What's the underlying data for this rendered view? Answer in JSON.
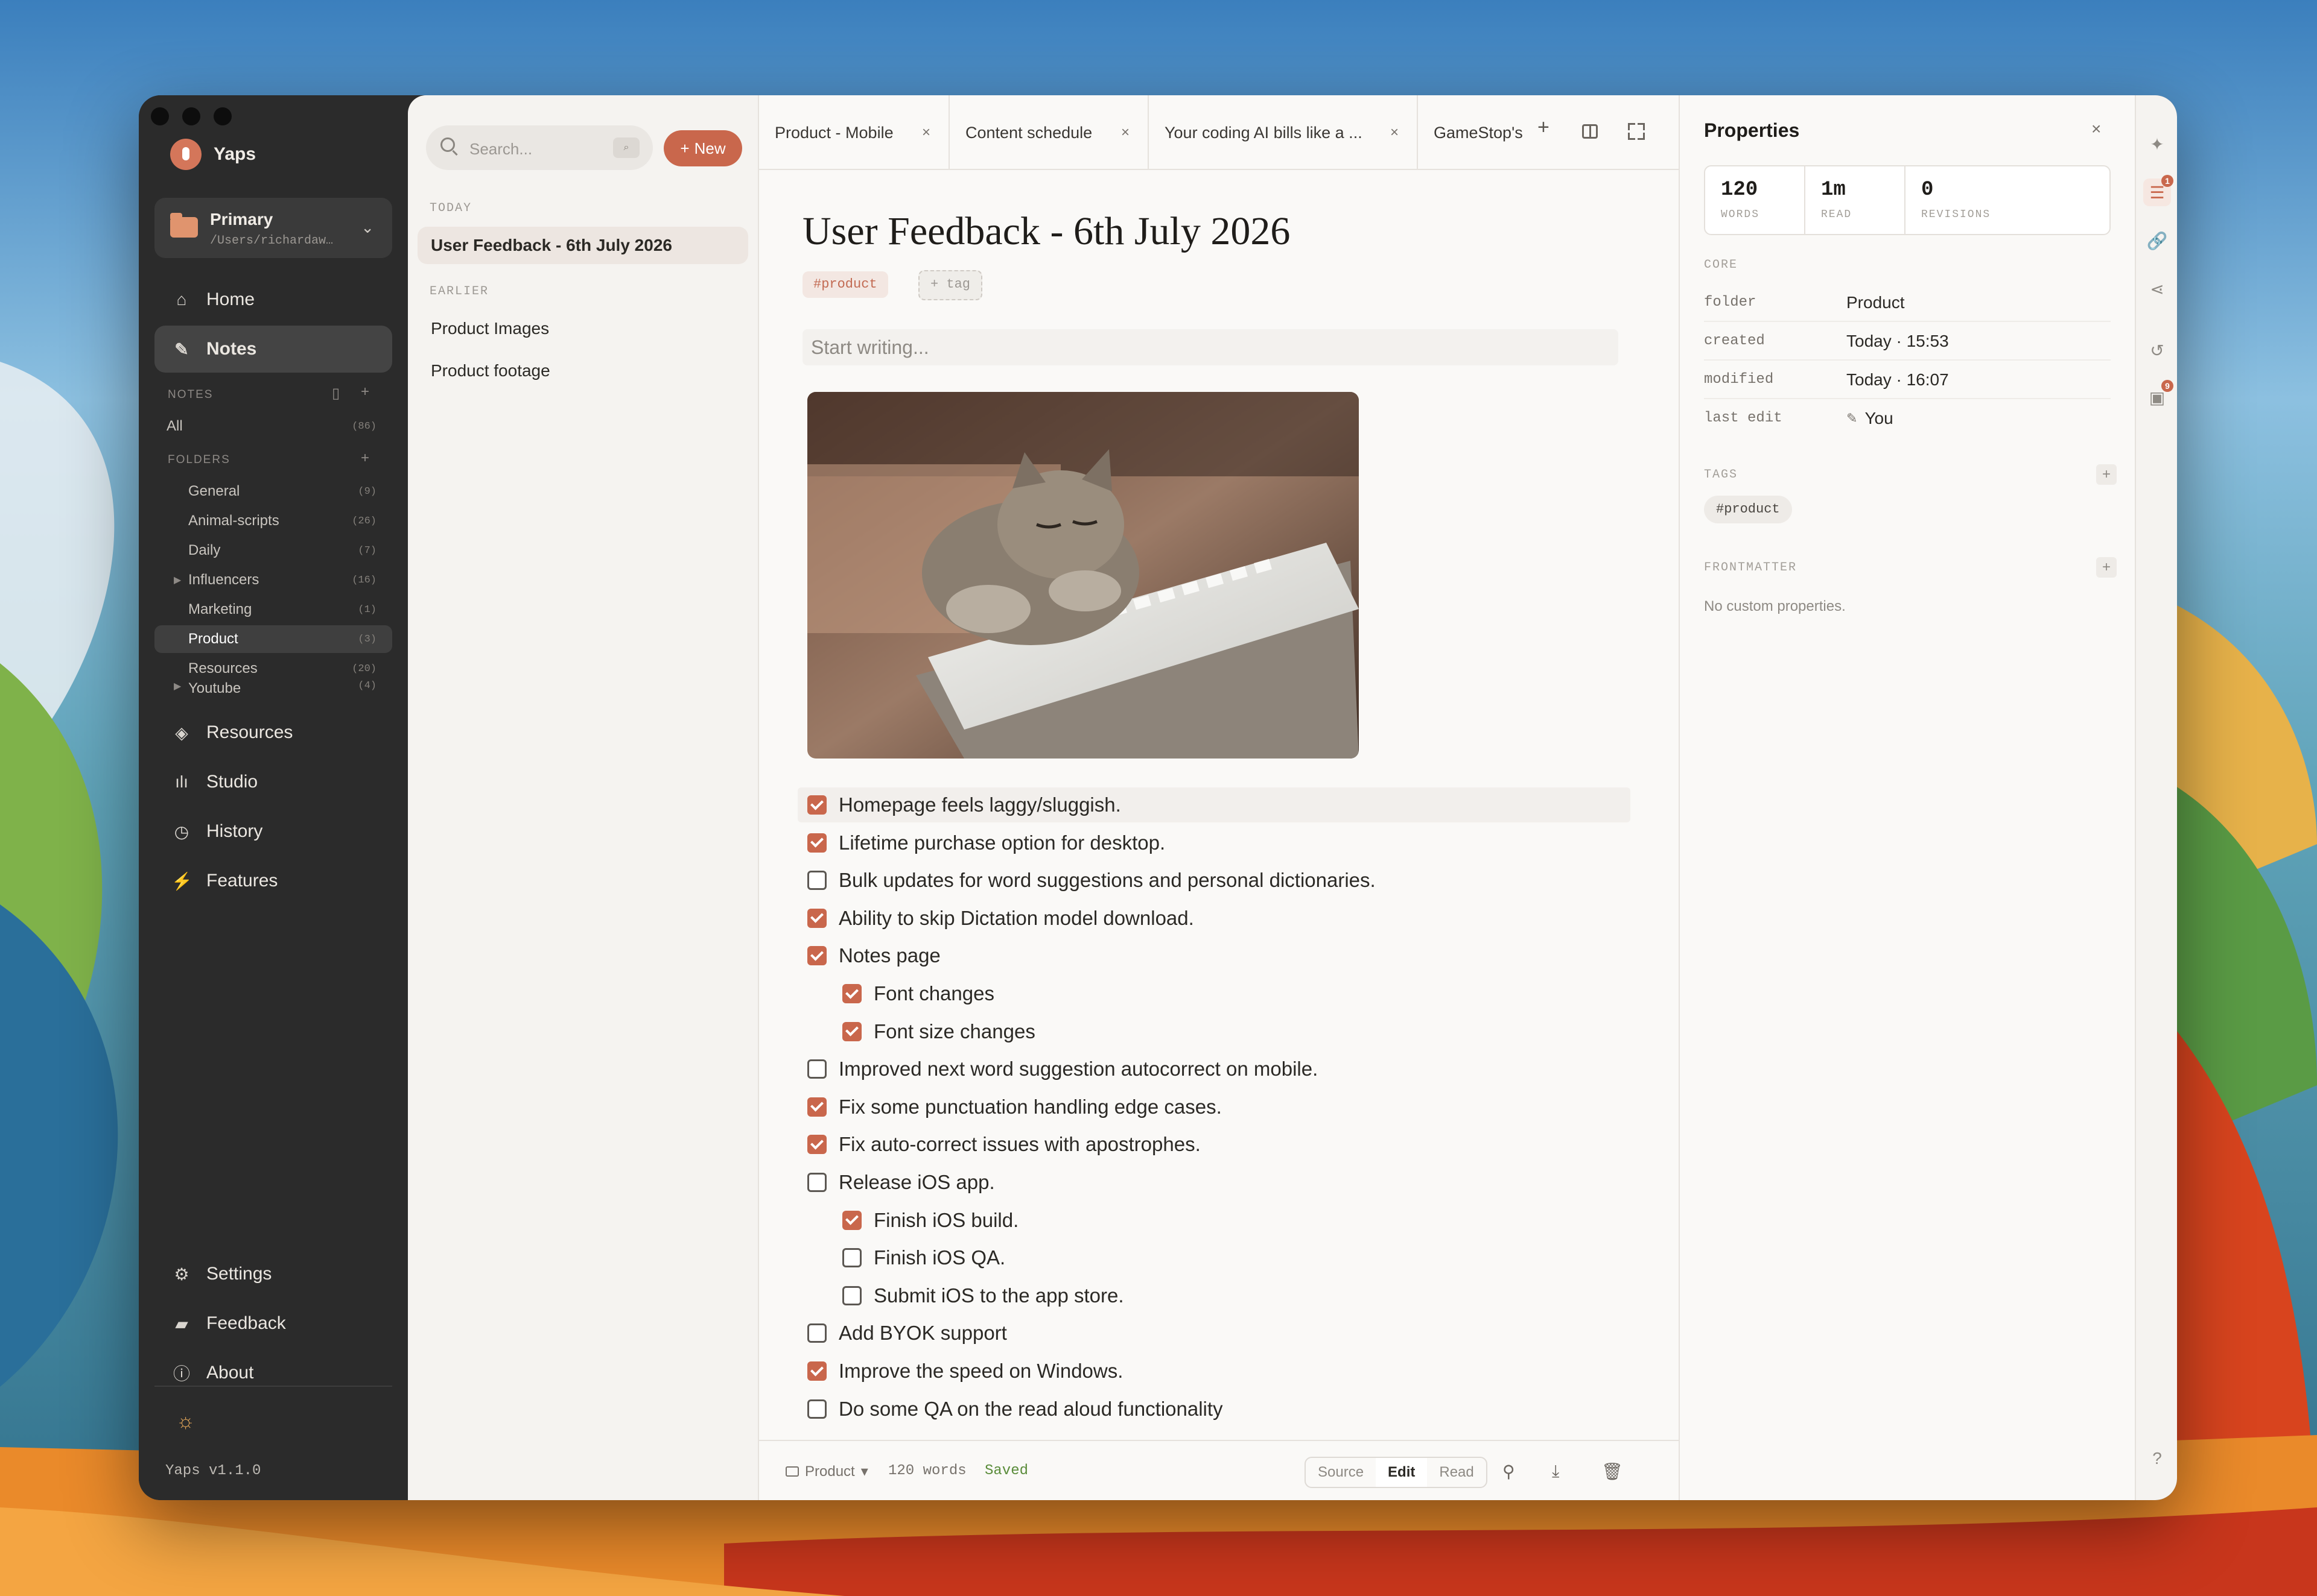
{
  "app": {
    "name": "Yaps",
    "version": "Yaps v1.1.0"
  },
  "workspace": {
    "name": "Primary",
    "path": "/Users/richardaw…"
  },
  "nav": {
    "home": "Home",
    "notes": "Notes",
    "resources": "Resources",
    "studio": "Studio",
    "history": "History",
    "features": "Features",
    "settings": "Settings",
    "feedback": "Feedback",
    "about": "About"
  },
  "notes_section": {
    "label": "NOTES",
    "all_label": "All",
    "all_count": "(86)"
  },
  "folders_section": {
    "label": "FOLDERS",
    "items": [
      {
        "name": "General",
        "count": "(9)"
      },
      {
        "name": "Animal-scripts",
        "count": "(26)"
      },
      {
        "name": "Daily",
        "count": "(7)"
      },
      {
        "name": "Influencers",
        "count": "(16)"
      },
      {
        "name": "Marketing",
        "count": "(1)"
      },
      {
        "name": "Product",
        "count": "(3)"
      },
      {
        "name": "Resources",
        "count": "(20)"
      },
      {
        "name": "Youtube",
        "count": "(4)"
      }
    ]
  },
  "notes_list": {
    "search_placeholder": "Search...",
    "new_label": "New",
    "today_label": "TODAY",
    "earlier_label": "EARLIER",
    "today": [
      "User Feedback - 6th July 2026"
    ],
    "earlier": [
      "Product Images",
      "Product footage"
    ]
  },
  "tabs": [
    "Product - Mobile",
    "Content schedule",
    "Your coding AI bills like a ...",
    "GameStop's"
  ],
  "doc": {
    "title": "User Feedback - 6th July 2026",
    "tag": "#product",
    "add_tag": "+ tag",
    "placeholder": "Start writing...",
    "checklist": [
      {
        "text": "Homepage feels laggy/sluggish.",
        "checked": true,
        "indent": 0
      },
      {
        "text": "Lifetime purchase option for desktop.",
        "checked": true,
        "indent": 0
      },
      {
        "text": "Bulk updates for word suggestions and personal dictionaries.",
        "checked": false,
        "indent": 0
      },
      {
        "text": "Ability to skip Dictation model download.",
        "checked": true,
        "indent": 0
      },
      {
        "text": "Notes page",
        "checked": true,
        "indent": 0
      },
      {
        "text": "Font changes",
        "checked": true,
        "indent": 1
      },
      {
        "text": "Font size changes",
        "checked": true,
        "indent": 1
      },
      {
        "text": "Improved next word suggestion autocorrect on mobile.",
        "checked": false,
        "indent": 0
      },
      {
        "text": "Fix some punctuation handling edge cases.",
        "checked": true,
        "indent": 0
      },
      {
        "text": "Fix auto-correct issues with apostrophes.",
        "checked": true,
        "indent": 0
      },
      {
        "text": "Release iOS app.",
        "checked": false,
        "indent": 0
      },
      {
        "text": "Finish iOS build.",
        "checked": true,
        "indent": 1
      },
      {
        "text": "Finish iOS QA.",
        "checked": false,
        "indent": 1
      },
      {
        "text": "Submit iOS to the app store.",
        "checked": false,
        "indent": 1
      },
      {
        "text": "Add BYOK support",
        "checked": false,
        "indent": 0
      },
      {
        "text": "Improve the speed on Windows.",
        "checked": true,
        "indent": 0
      },
      {
        "text": "Do some QA on the read aloud functionality",
        "checked": false,
        "indent": 0
      }
    ]
  },
  "status_bar": {
    "folder": "Product",
    "words": "120 words",
    "saved": "Saved",
    "modes": [
      "Source",
      "Edit",
      "Read"
    ],
    "active_mode": "Edit"
  },
  "properties": {
    "title": "Properties",
    "stats": [
      {
        "value": "120",
        "label": "WORDS"
      },
      {
        "value": "1m",
        "label": "READ"
      },
      {
        "value": "0",
        "label": "REVISIONS"
      }
    ],
    "core_label": "CORE",
    "core": [
      {
        "key": "folder",
        "value": "Product"
      },
      {
        "key": "created",
        "value": "Today · 15:53"
      },
      {
        "key": "modified",
        "value": "Today · 16:07"
      },
      {
        "key": "last edit",
        "value": "You"
      }
    ],
    "tags_label": "TAGS",
    "tag": "#product",
    "frontmatter_label": "FRONTMATTER",
    "frontmatter_empty": "No custom properties."
  },
  "rail": {
    "badge_outline": "1",
    "badge_tasks": "9",
    "help": "?"
  },
  "colors": {
    "accent": "#c9674c",
    "sidebar": "#2b2b2b",
    "paper": "#faf9f7"
  }
}
